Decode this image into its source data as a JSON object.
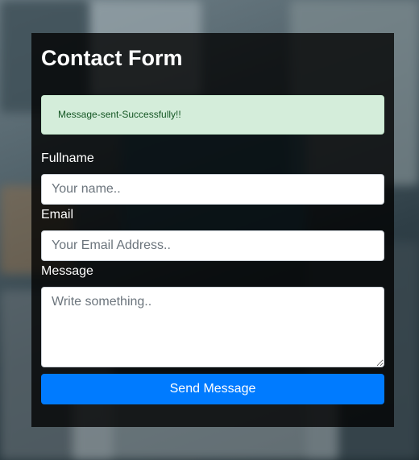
{
  "form": {
    "title": "Contact Form",
    "alert_message": "Message-sent-Successfully!!",
    "fullname_label": "Fullname",
    "fullname_placeholder": "Your name..",
    "email_label": "Email",
    "email_placeholder": "Your Email Address..",
    "message_label": "Message",
    "message_placeholder": "Write something..",
    "submit_label": "Send Message"
  },
  "colors": {
    "alert_bg": "#d4edda",
    "alert_text": "#155724",
    "button_bg": "#007bff",
    "panel_bg": "rgba(0,0,0,0.78)"
  }
}
